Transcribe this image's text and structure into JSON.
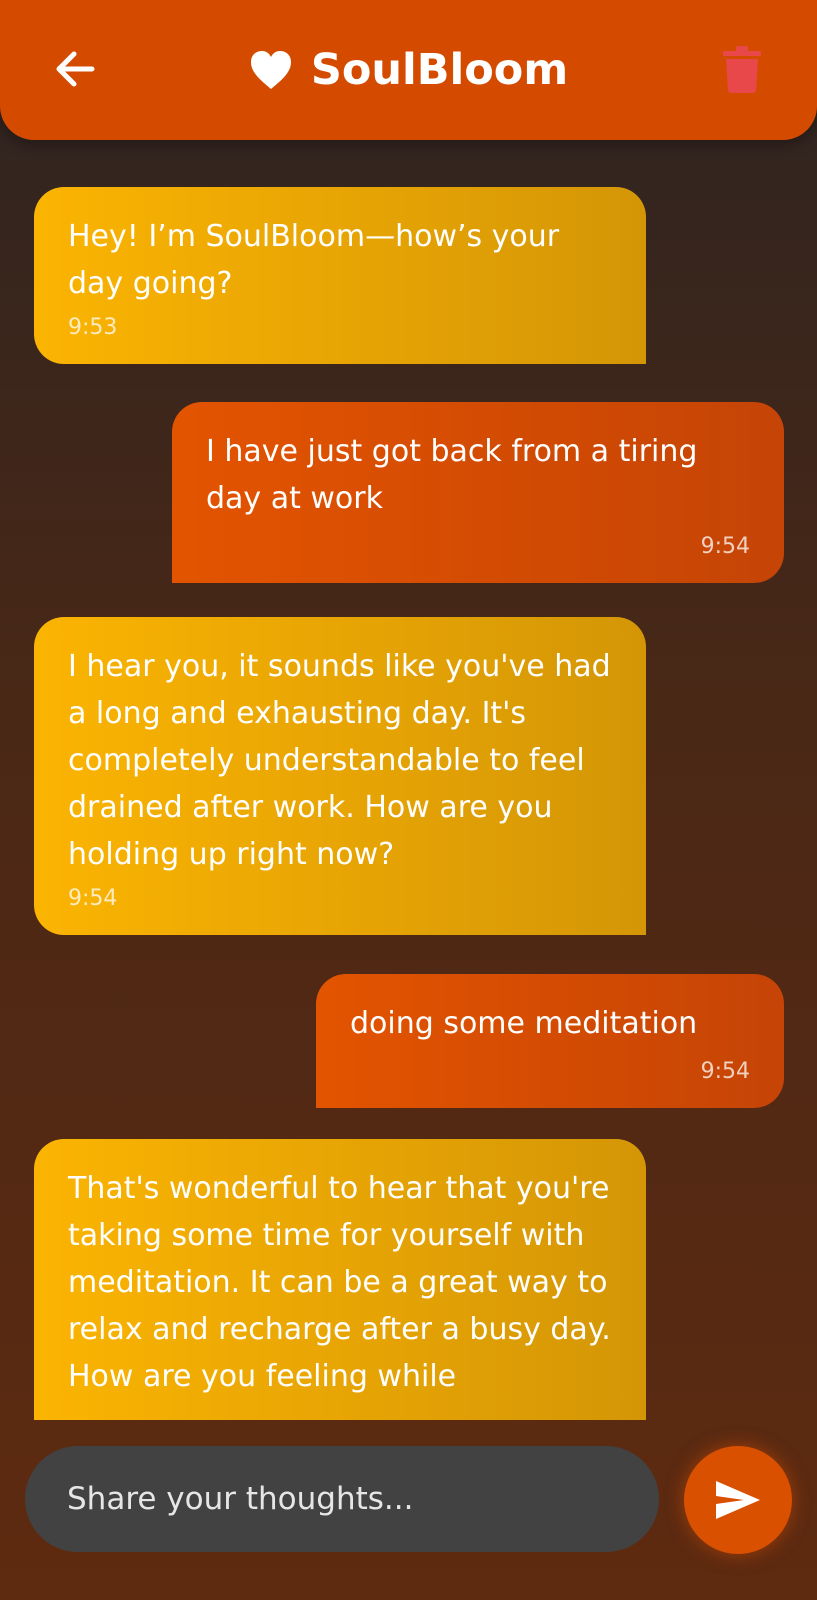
{
  "header": {
    "title": "SoulBloom",
    "back_icon": "arrow-left-icon",
    "heart_icon": "heart-icon",
    "delete_icon": "trash-icon"
  },
  "colors": {
    "header_bg": "#d44b00",
    "bot_bubble_start": "#fbb402",
    "bot_bubble_end": "#d49606",
    "user_bubble_start": "#e35400",
    "user_bubble_end": "#c54406",
    "trash_icon": "#e8484a",
    "input_bg": "#424242"
  },
  "messages": [
    {
      "sender": "bot",
      "text": "Hey! I’m SoulBloom—how’s your day going?",
      "time": "9:53"
    },
    {
      "sender": "user",
      "text": "I have just got back from a tiring day at work",
      "time": "9:54"
    },
    {
      "sender": "bot",
      "text": "I hear you, it sounds like you've had a long and exhausting day. It's completely understandable to feel drained after work. How are you holding up right now?",
      "time": "9:54"
    },
    {
      "sender": "user",
      "text": "doing some meditation",
      "time": "9:54"
    },
    {
      "sender": "bot",
      "text": "That's wonderful to hear that you're taking some time for yourself with meditation. It can be a great way to relax and recharge after a busy day. How are you feeling while",
      "time": ""
    }
  ],
  "input": {
    "placeholder": "Share your thoughts...",
    "send_icon": "send-icon"
  }
}
